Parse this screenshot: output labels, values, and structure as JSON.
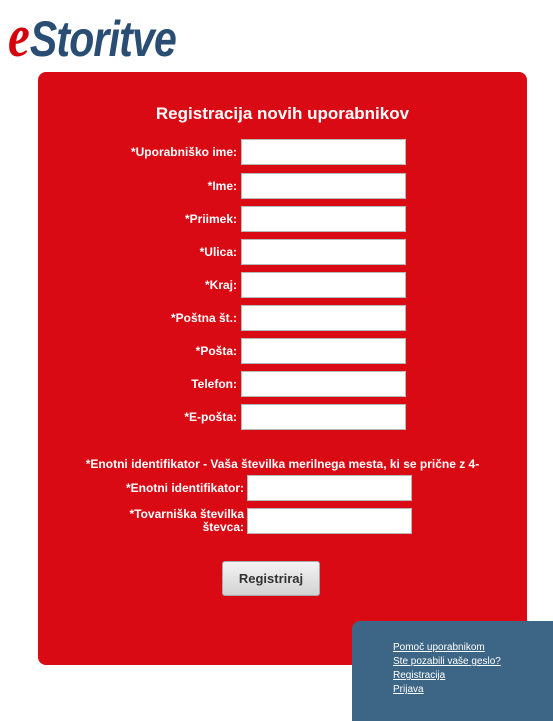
{
  "logo": {
    "prefix": "e",
    "rest": "Storitve"
  },
  "title": "Registracija novih uporabnikov",
  "fields": [
    {
      "label": "*Uporabniško ime:",
      "value": ""
    },
    {
      "label": "*Ime:",
      "value": ""
    },
    {
      "label": "*Priimek:",
      "value": ""
    },
    {
      "label": "*Ulica:",
      "value": ""
    },
    {
      "label": "*Kraj:",
      "value": ""
    },
    {
      "label": "*Poštna št.:",
      "value": ""
    },
    {
      "label": "*Pošta:",
      "value": ""
    },
    {
      "label": "Telefon:",
      "value": ""
    },
    {
      "label": "*E-pošta:",
      "value": ""
    }
  ],
  "note": "*Enotni identifikator - Vaša številka merilnega mesta, ki se prične z 4-",
  "extra_fields": {
    "identifier": {
      "label": "*Enotni identifikator:",
      "value": ""
    },
    "meter": {
      "label_line1": "*Tovarniška številka",
      "label_line2": "števca:",
      "value": ""
    }
  },
  "submit_label": "Registriraj",
  "help_links": [
    "Pomoč uporabnikom",
    "Ste pozabili vaše geslo?",
    "Registracija",
    "Prijava"
  ]
}
